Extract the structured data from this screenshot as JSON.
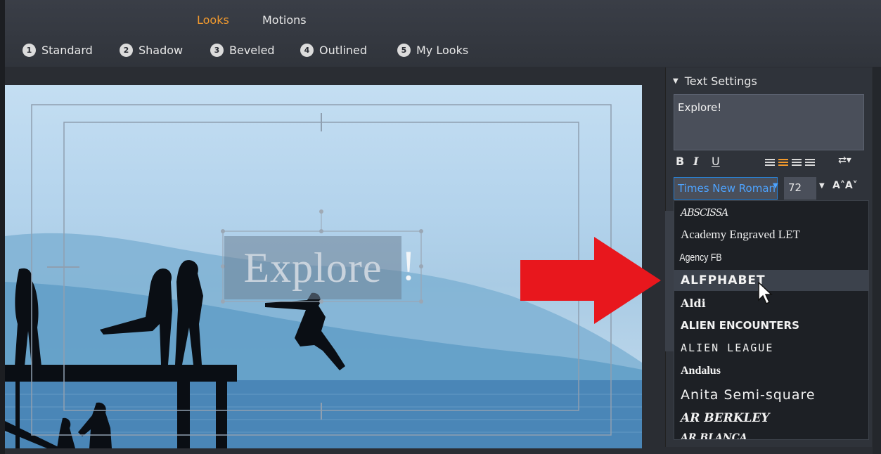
{
  "mode_tabs": [
    {
      "label": "Looks",
      "active": true
    },
    {
      "label": "Motions",
      "active": false
    }
  ],
  "style_tabs": [
    {
      "num": "1",
      "label": "Standard"
    },
    {
      "num": "2",
      "label": "Shadow"
    },
    {
      "num": "3",
      "label": "Beveled"
    },
    {
      "num": "4",
      "label": "Outlined"
    },
    {
      "num": "5",
      "label": "My Looks"
    }
  ],
  "canvas": {
    "title_text": "Explore",
    "title_excl": "!"
  },
  "text_settings": {
    "header": "Text Settings",
    "text_value": "Explore!",
    "bold": "B",
    "italic": "I",
    "underline": "U",
    "font_value": "Times New Roman",
    "size_value": "72",
    "grow_label": "A˄A˅"
  },
  "font_list": {
    "items": [
      "ABSCISSA",
      "Academy Engraved LET",
      "Agency FB",
      "ALFPHABET",
      "Aldi",
      "ALIEN ENCOUNTERS",
      "ALIEN LEAGUE",
      "Andalus",
      "Anita Semi-square",
      "AR BERKLEY",
      "AR BLANCA"
    ],
    "hovered_index": 3
  },
  "colors": {
    "accent": "#f29a2e",
    "selection_blue": "#4da3ff",
    "arrow_red": "#e8171d"
  }
}
